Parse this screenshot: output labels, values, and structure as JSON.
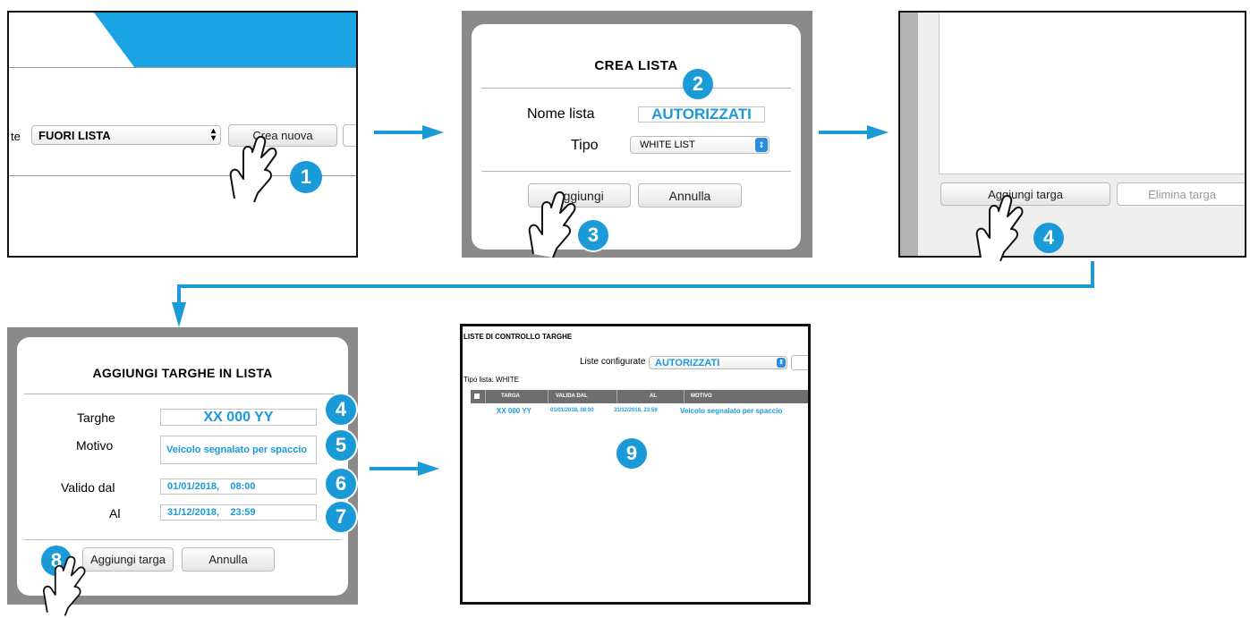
{
  "colors": {
    "accent": "#1a9ad6",
    "select_arrow": "#2a8be0",
    "table_header": "#6e6e6e",
    "overlay": "#8a8a8a"
  },
  "step1": {
    "cut_label": "te",
    "select_value": "FUORI LISTA",
    "create_button": "Crea nuova",
    "badge": "1"
  },
  "step2": {
    "title": "CREA LISTA",
    "name_label": "Nome lista",
    "name_value": "AUTORIZZATI",
    "type_label": "Tipo",
    "type_value": "WHITE LIST",
    "add_button": "Aggiungi",
    "cancel_button": "Annulla",
    "badge_name": "2",
    "badge_add": "3"
  },
  "step3": {
    "add_plate_button": "Aggiungi targa",
    "delete_plate_button": "Elimina targa",
    "badge": "4"
  },
  "step4": {
    "title": "AGGIUNGI TARGHE IN LISTA",
    "plates_label": "Targhe",
    "plates_value": "XX 000 YY",
    "reason_label": "Motivo",
    "reason_value": "Veicolo segnalato per spaccio",
    "from_label": "Valido dal",
    "from_value": "01/01/2018,    08:00",
    "to_label": "Al",
    "to_value": "31/12/2018,    23:59",
    "add_button": "Aggiungi targa",
    "cancel_button": "Annulla",
    "badge_plates": "4",
    "badge_reason": "5",
    "badge_from": "6",
    "badge_to": "7",
    "badge_add": "8"
  },
  "step5": {
    "heading": "LISTE DI CONTROLLO TARGHE",
    "lists_label": "Liste configurate",
    "lists_value": "AUTORIZZATI",
    "type_text": "Tipo lista: WHITE",
    "columns": [
      "TARGA",
      "VALIDA DAL",
      "AL",
      "MOTIVO"
    ],
    "row": {
      "plate": "XX 000 YY",
      "from": "01/01/2018, 08:00",
      "to": "31/12/2018, 23:59",
      "reason": "Veicolo segnalato per spaccio"
    },
    "badge": "9"
  }
}
